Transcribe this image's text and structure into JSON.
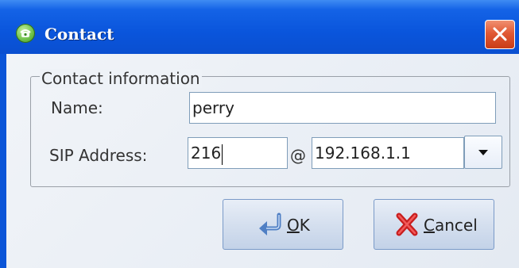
{
  "window": {
    "title": "Contact",
    "close_label": "close"
  },
  "group": {
    "title": "Contact information"
  },
  "form": {
    "name_label": "Name:",
    "name_value": "perry",
    "sip_label": "SIP Address:",
    "sip_user_value": "216",
    "at_symbol": "@",
    "sip_host_value": "192.168.1.1"
  },
  "buttons": {
    "ok_mnemonic": "O",
    "ok_rest": "K",
    "cancel_mnemonic": "C",
    "cancel_rest": "ancel"
  },
  "icons": {
    "title": "phone-icon",
    "close": "close-icon",
    "dropdown": "chevron-down-icon",
    "ok": "enter-arrow-icon",
    "cancel": "red-x-icon"
  },
  "colors": {
    "titlebar": "#0a55dc",
    "close_button": "#e15a35",
    "client_bg": "#eef2f7"
  }
}
